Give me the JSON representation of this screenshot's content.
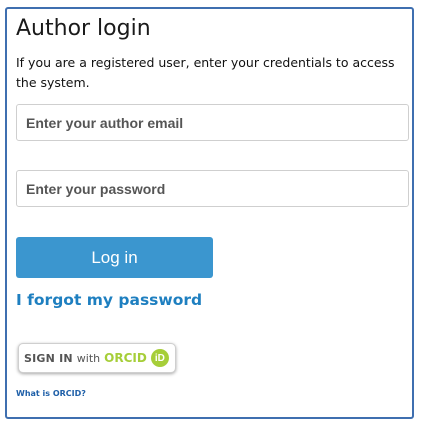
{
  "login": {
    "title": "Author login",
    "intro": "If you are a registered user, enter your credentials to access the system.",
    "email_placeholder": "Enter your author email",
    "email_value": "",
    "password_placeholder": "Enter your password",
    "password_value": "",
    "login_label": "Log in",
    "forgot_label": "I forgot my password"
  },
  "orcid": {
    "sign_in": "SIGN IN",
    "with": "with",
    "brand": "ORCID",
    "icon_text": "iD",
    "help_link": "What is ORCID?"
  },
  "colors": {
    "panel_border": "#3f6fb0",
    "primary_button": "#3b96cf",
    "link": "#1e7fc0",
    "orcid_green": "#a6ce39"
  },
  "icons": {
    "orcid": "orcid-id-icon"
  }
}
